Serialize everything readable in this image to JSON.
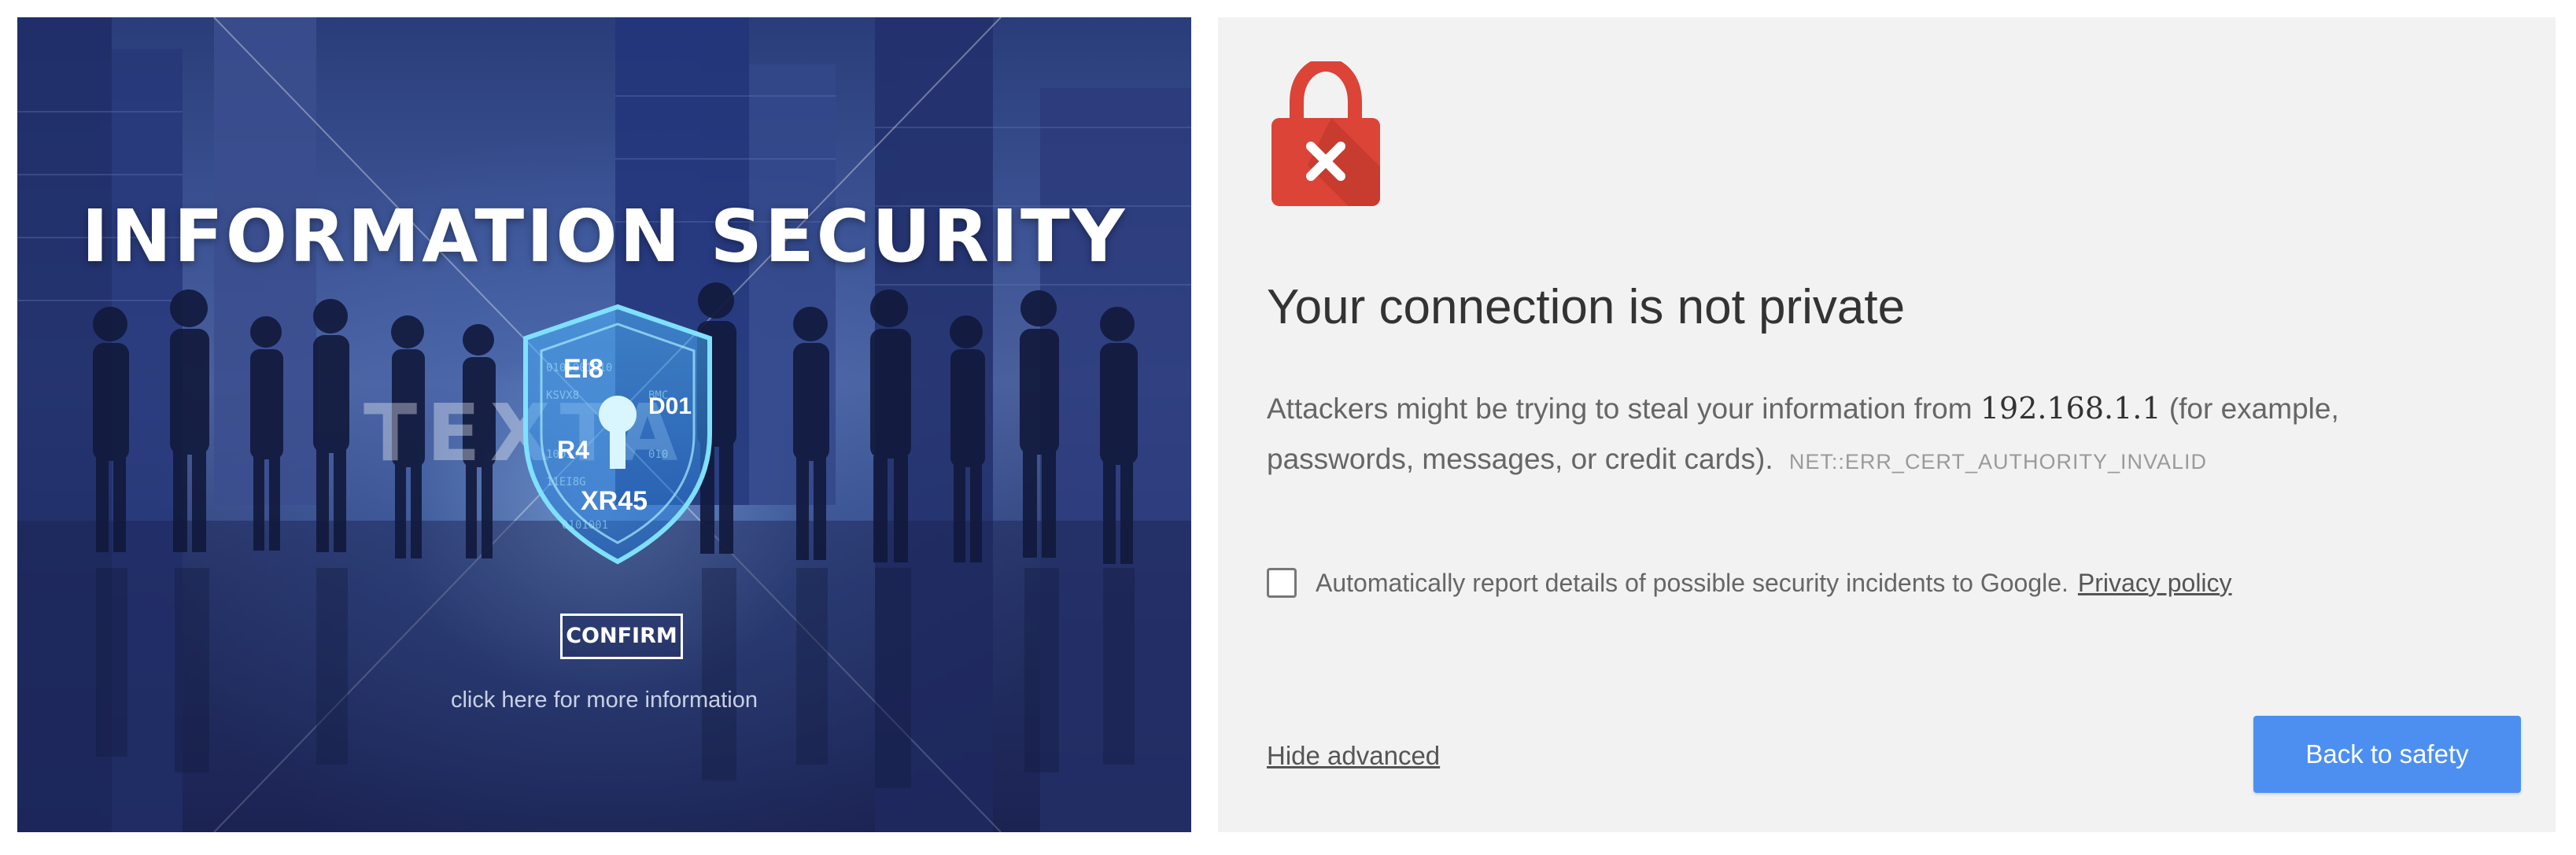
{
  "left_panel": {
    "title": "INFORMATION SECURITY",
    "watermark": "TEXTA",
    "shield_glyphs": {
      "line1": "EI8",
      "line2": "D01",
      "line3": "R4",
      "line4": "XR45"
    },
    "confirm_label": "CONFIRM",
    "more_info": "click here for more information",
    "icons": {
      "shield": "shield-keyhole-icon"
    }
  },
  "right_panel": {
    "icons": {
      "lock": "lock-error-icon"
    },
    "colors": {
      "lock_red": "#db4437",
      "button_blue": "#4c8ff1",
      "background": "#f2f2f2"
    },
    "heading": "Your connection is not private",
    "body": {
      "prefix": "Attackers might be trying to steal your information from",
      "host": "192.168.1.1",
      "suffix": "(for example, passwords, messages, or credit cards).",
      "error_code": "NET::ERR_CERT_AUTHORITY_INVALID"
    },
    "report": {
      "label": "Automatically report details of possible security incidents to Google.",
      "checked": false,
      "link": "Privacy policy"
    },
    "hide_advanced": "Hide advanced",
    "back_button": "Back to safety"
  }
}
